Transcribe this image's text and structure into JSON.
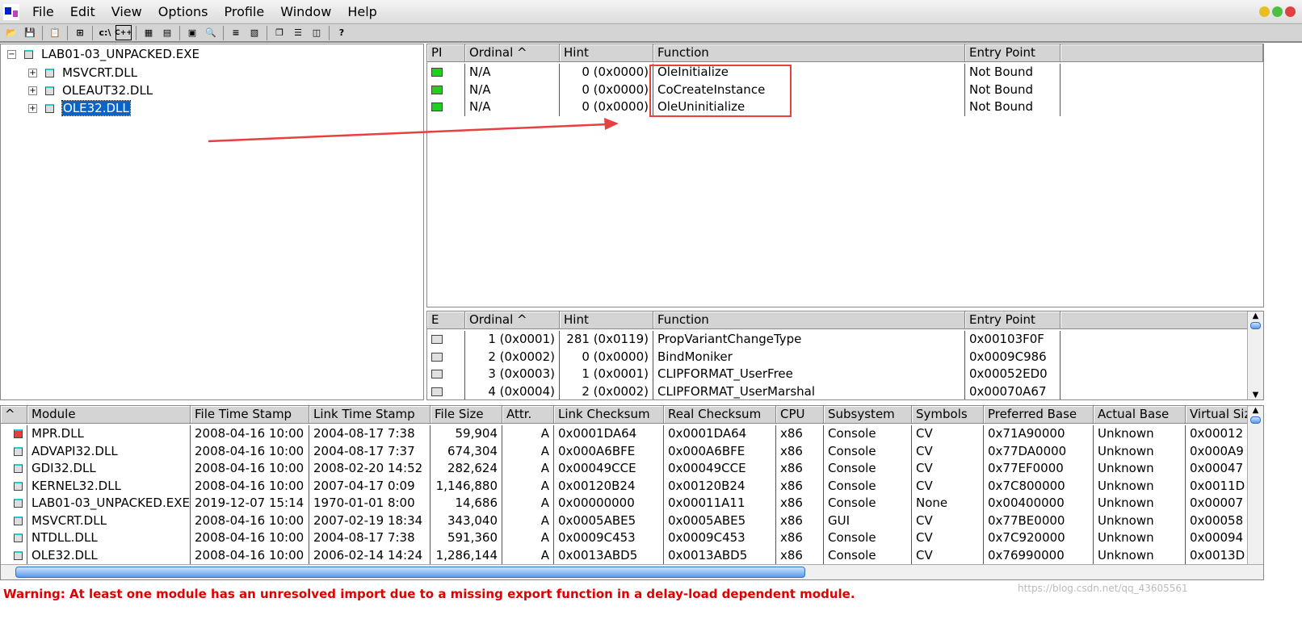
{
  "menu": [
    "File",
    "Edit",
    "View",
    "Options",
    "Profile",
    "Window",
    "Help"
  ],
  "toolbar_icons": [
    "open-icon",
    "save-icon",
    "copy-icon",
    "tree-icon",
    "c-path-icon",
    "cpp-icon",
    "view-icon",
    "properties-icon",
    "system-info-icon",
    "find-icon",
    "sort-icon",
    "external-icon",
    "cascade-icon",
    "tile-horizontal-icon",
    "tile-vertical-icon",
    "help-icon"
  ],
  "toolbar_text": {
    "c": "c:\\",
    "cpp": "C++"
  },
  "tree": {
    "root": "LAB01-03_UNPACKED.EXE",
    "children": [
      "MSVCRT.DLL",
      "OLEAUT32.DLL",
      "OLE32.DLL"
    ],
    "selected": "OLE32.DLL"
  },
  "imports": {
    "headers": [
      "PI",
      "Ordinal ^",
      "Hint",
      "Function",
      "Entry Point"
    ],
    "rows": [
      [
        "N/A",
        "0 (0x0000)",
        "OleInitialize",
        "Not Bound"
      ],
      [
        "N/A",
        "0 (0x0000)",
        "CoCreateInstance",
        "Not Bound"
      ],
      [
        "N/A",
        "0 (0x0000)",
        "OleUninitialize",
        "Not Bound"
      ]
    ]
  },
  "exports": {
    "headers": [
      "E",
      "Ordinal ^",
      "Hint",
      "Function",
      "Entry Point"
    ],
    "rows": [
      [
        "1 (0x0001)",
        "281 (0x0119)",
        "PropVariantChangeType",
        "0x00103F0F"
      ],
      [
        "2 (0x0002)",
        "0 (0x0000)",
        "BindMoniker",
        "0x0009C986"
      ],
      [
        "3 (0x0003)",
        "1 (0x0001)",
        "CLIPFORMAT_UserFree",
        "0x00052ED0"
      ],
      [
        "4 (0x0004)",
        "2 (0x0002)",
        "CLIPFORMAT_UserMarshal",
        "0x00070A67"
      ]
    ]
  },
  "modules": {
    "headers": [
      "^",
      "Module",
      "File Time Stamp",
      "Link Time Stamp",
      "File Size",
      "Attr.",
      "Link Checksum",
      "Real Checksum",
      "CPU",
      "Subsystem",
      "Symbols",
      "Preferred Base",
      "Actual Base",
      "Virtual Size"
    ],
    "rows": [
      [
        "MPR.DLL",
        "2008-04-16 10:00",
        "2004-08-17  7:38",
        "59,904",
        "A",
        "0x0001DA64",
        "0x0001DA64",
        "x86",
        "Console",
        "CV",
        "0x71A90000",
        "Unknown",
        "0x00012"
      ],
      [
        "ADVAPI32.DLL",
        "2008-04-16 10:00",
        "2004-08-17  7:37",
        "674,304",
        "A",
        "0x000A6BFE",
        "0x000A6BFE",
        "x86",
        "Console",
        "CV",
        "0x77DA0000",
        "Unknown",
        "0x000A9"
      ],
      [
        "GDI32.DLL",
        "2008-04-16 10:00",
        "2008-02-20 14:52",
        "282,624",
        "A",
        "0x00049CCE",
        "0x00049CCE",
        "x86",
        "Console",
        "CV",
        "0x77EF0000",
        "Unknown",
        "0x00047"
      ],
      [
        "KERNEL32.DLL",
        "2008-04-16 10:00",
        "2007-04-17  0:09",
        "1,146,880",
        "A",
        "0x00120B24",
        "0x00120B24",
        "x86",
        "Console",
        "CV",
        "0x7C800000",
        "Unknown",
        "0x0011D"
      ],
      [
        "LAB01-03_UNPACKED.EXE",
        "2019-12-07 15:14",
        "1970-01-01  8:00",
        "14,686",
        "A",
        "0x00000000",
        "0x00011A11",
        "x86",
        "Console",
        "None",
        "0x00400000",
        "Unknown",
        "0x00007"
      ],
      [
        "MSVCRT.DLL",
        "2008-04-16 10:00",
        "2007-02-19 18:34",
        "343,040",
        "A",
        "0x0005ABE5",
        "0x0005ABE5",
        "x86",
        "GUI",
        "CV",
        "0x77BE0000",
        "Unknown",
        "0x00058"
      ],
      [
        "NTDLL.DLL",
        "2008-04-16 10:00",
        "2004-08-17  7:38",
        "591,360",
        "A",
        "0x0009C453",
        "0x0009C453",
        "x86",
        "Console",
        "CV",
        "0x7C920000",
        "Unknown",
        "0x00094"
      ],
      [
        "OLE32.DLL",
        "2008-04-16 10:00",
        "2006-02-14 14:24",
        "1,286,144",
        "A",
        "0x0013ABD5",
        "0x0013ABD5",
        "x86",
        "Console",
        "CV",
        "0x76990000",
        "Unknown",
        "0x0013D"
      ]
    ]
  },
  "status": "Warning: At least one module has an unresolved import due to a missing export function in a delay-load dependent module.",
  "watermark": "https://blog.csdn.net/qq_43605561",
  "colors": {
    "annotation": "#e84040",
    "selection": "#0a64c8",
    "warning": "#e00000"
  }
}
